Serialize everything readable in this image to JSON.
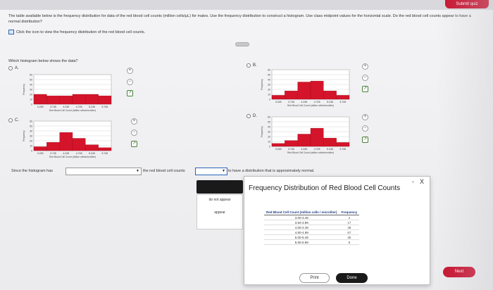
{
  "header": {
    "submit_label": "Submit quiz"
  },
  "question": {
    "text": "The table available below is the frequency distribution for data of the red blood cell counts (million cells/µL) for males. Use the frequency distribution to construct a histogram. Use class midpoint values for the horizontal scale. Do the red blood cell counts appear to have a normal distribution?",
    "icon_instruction": "Click the icon to view the frequency distribution of the red blood cell counts.",
    "which": "Which histogram below shows the data?"
  },
  "options": [
    {
      "label": "A.",
      "heights": [
        20,
        17,
        17,
        20,
        20,
        17
      ]
    },
    {
      "label": "B.",
      "heights": [
        8,
        17,
        35,
        37,
        17,
        8
      ]
    },
    {
      "label": "C.",
      "heights": [
        8,
        17,
        37,
        25,
        12,
        6
      ]
    },
    {
      "label": "D.",
      "heights": [
        6,
        12,
        25,
        37,
        17,
        8
      ]
    }
  ],
  "histogram_common": {
    "xticks": [
      "3.245",
      "3.745",
      "4.245",
      "4.745",
      "5.245",
      "5.745"
    ],
    "yticks": [
      "0",
      "10",
      "20",
      "30",
      "40",
      "50",
      "60"
    ],
    "xlabel": "Red Blood Cell Count (million cells/microliter)",
    "ylabel": "Frequency",
    "bar_color": "#d4142a"
  },
  "sentence": {
    "prefix": "Since the histogram has",
    "middle": "the red blood cell counts",
    "suffix": "to have a distribution that is approximately normal."
  },
  "dropdown": {
    "options": [
      "do not appear",
      "appear"
    ]
  },
  "popup": {
    "title": "Frequency Distribution of Red Blood Cell Counts",
    "col1": "Red Blood Cell Count (million cells / microliter)",
    "col2": "Frequency",
    "rows": [
      {
        "range": "3.00-3.49",
        "freq": "4"
      },
      {
        "range": "3.50-3.99",
        "freq": "17"
      },
      {
        "range": "4.00-4.49",
        "freq": "48"
      },
      {
        "range": "4.50-4.99",
        "freq": "57"
      },
      {
        "range": "5.00-5.49",
        "freq": "35"
      },
      {
        "range": "5.50-5.99",
        "freq": "8"
      }
    ],
    "print_label": "Print",
    "done_label": "Done",
    "minimize": "-",
    "close": "X"
  },
  "footer": {
    "next_label": "Next"
  },
  "icons": {
    "zoom_in": "zoom-in-icon",
    "zoom_out": "zoom-out-icon",
    "external": "external-link-icon",
    "table": "table-icon"
  }
}
